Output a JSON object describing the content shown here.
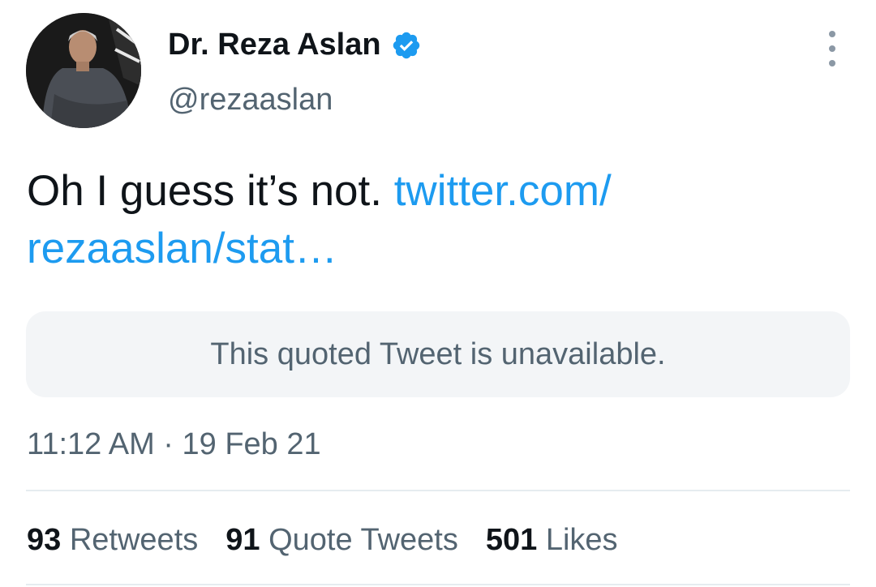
{
  "author": {
    "display_name": "Dr. Reza Aslan",
    "handle": "@rezaaslan",
    "verified": true,
    "avatar_icon": "profile-photo"
  },
  "tweet": {
    "text": "Oh I guess it’s not. ",
    "link_text": "twitter.com/​rezaaslan/stat…",
    "link_line1": "twitter.com/",
    "link_line2": "rezaaslan/stat…"
  },
  "quoted_tweet": {
    "message": "This quoted Tweet is unavailable."
  },
  "timestamp": "11:12 AM · 19 Feb 21",
  "stats": {
    "retweets_count": "93",
    "retweets_label": "Retweets",
    "quote_tweets_count": "91",
    "quote_tweets_label": "Quote Tweets",
    "likes_count": "501",
    "likes_label": "Likes"
  },
  "colors": {
    "link": "#1d9bf0",
    "verified_badge": "#1d9bf0",
    "secondary_text": "#536471"
  }
}
